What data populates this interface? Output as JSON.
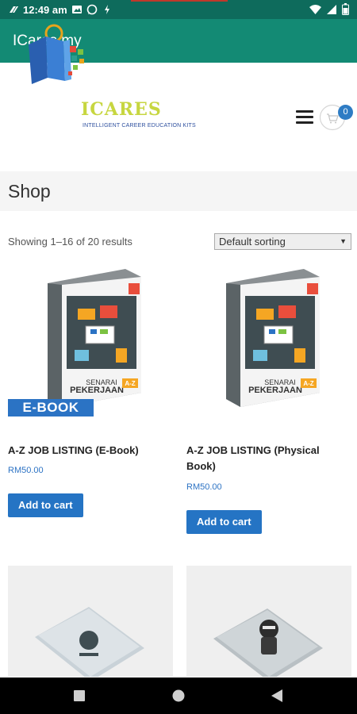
{
  "status_bar": {
    "time": "12:49 am"
  },
  "app_bar": {
    "title": "ICares my"
  },
  "header": {
    "logo_main": "ICARES",
    "logo_sub": "INTELLIGENT CAREER EDUCATION KITS",
    "cart_count": "0"
  },
  "shop": {
    "title": "Shop",
    "results_text": "Showing 1–16 of 20 results",
    "sort_selected": "Default sorting"
  },
  "products": [
    {
      "badge": "E-BOOK",
      "cover_title_1": "SENARAI",
      "cover_title_2": "PEKERJAAN",
      "cover_corner": "A-Z",
      "name": "A-Z JOB LISTING (E-Book)",
      "price": "RM50.00",
      "button": "Add to cart"
    },
    {
      "cover_title_1": "SENARAI",
      "cover_title_2": "PEKERJAAN",
      "cover_corner": "A-Z",
      "name_line1": "A-Z JOB LISTING (Physical",
      "name_line2": "Book)",
      "price": "RM50.00",
      "button": "Add to cart"
    }
  ],
  "icons": {
    "status": [
      "network-icon",
      "gallery-icon",
      "whatsapp-icon",
      "charging-icon",
      "wifi-icon",
      "signal-icon",
      "battery-icon"
    ],
    "header": [
      "hamburger-menu-icon",
      "cart-icon"
    ],
    "nav": [
      "recents-icon",
      "home-icon",
      "back-icon"
    ]
  },
  "colors": {
    "status_bar": "#0e6b5c",
    "app_bar": "#138a74",
    "accent": "#2574c4"
  }
}
